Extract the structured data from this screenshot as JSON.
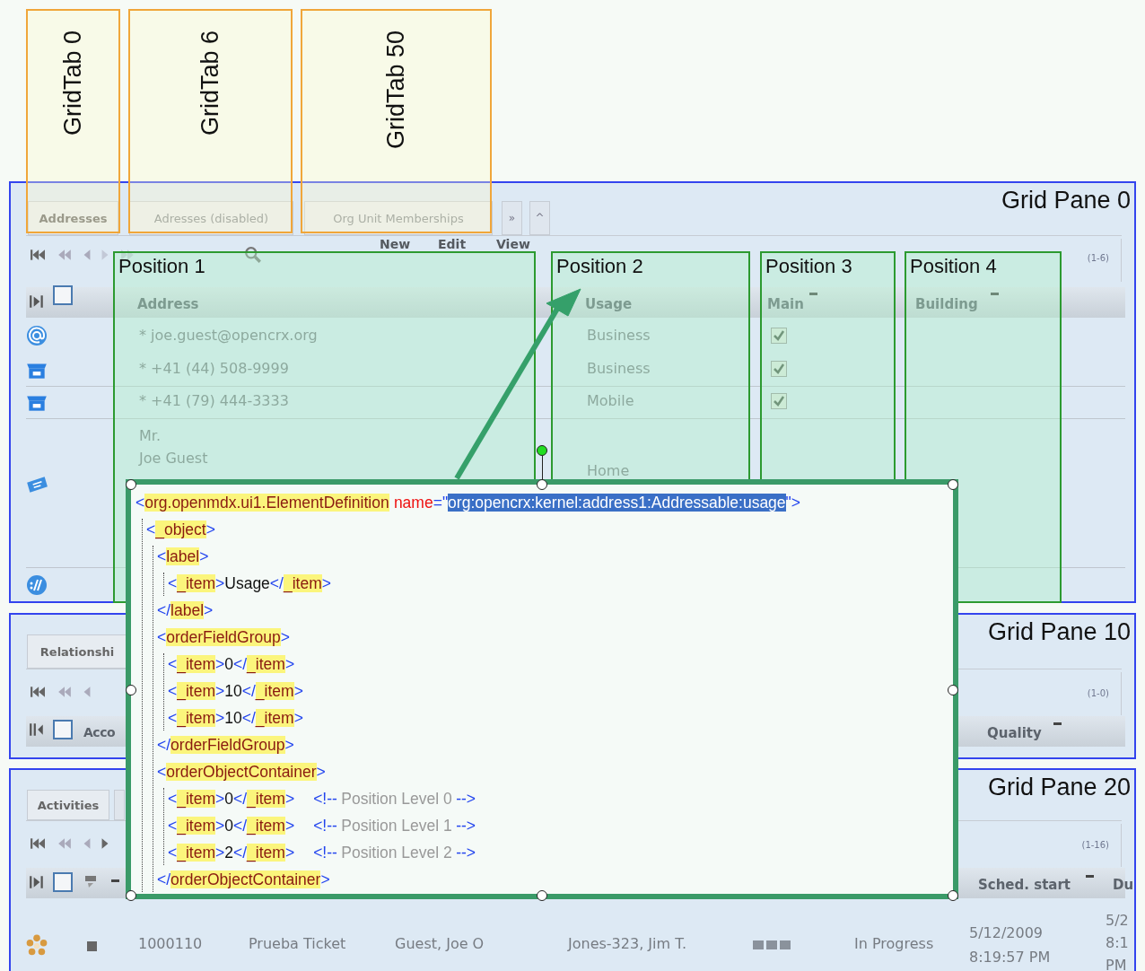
{
  "grid_tabs": [
    {
      "label": "GridTab 0"
    },
    {
      "label": "GridTab 6"
    },
    {
      "label": "GridTab 50"
    }
  ],
  "pane0": {
    "title": "Grid Pane 0",
    "tabs": [
      {
        "label": "Addresses",
        "disabled": false
      },
      {
        "label": "Adresses (disabled)",
        "disabled": true
      },
      {
        "label": "Org Unit Memberships",
        "disabled": true
      }
    ],
    "more": "»",
    "collapse": "^",
    "actions": [
      "New",
      "Edit",
      "View"
    ],
    "count": "(1-6)",
    "select_all": false,
    "columns": [
      {
        "label": "Address",
        "sortable": false
      },
      {
        "label": "Usage",
        "sortable": false
      },
      {
        "label": "Main",
        "sortable": true
      },
      {
        "label": "Building",
        "sortable": true
      }
    ],
    "rows": [
      {
        "kind": "email",
        "address": [
          "* joe.guest@opencrx.org"
        ],
        "usage": "Business",
        "main": true
      },
      {
        "kind": "phone",
        "address": [
          "* +41 (44) 508-9999"
        ],
        "usage": "Business",
        "main": true
      },
      {
        "kind": "phone",
        "address": [
          "* +41 (79) 444-3333"
        ],
        "usage": "Mobile",
        "main": true
      },
      {
        "kind": "postal",
        "address": [
          "Mr.",
          "Joe Guest"
        ],
        "usage": "Home"
      },
      {
        "kind": "web",
        "address": []
      }
    ]
  },
  "position_boxes": [
    "Position 1",
    "Position 2",
    "Position 3",
    "Position 4"
  ],
  "pane10": {
    "title": "Grid Pane 10",
    "tab": "Relationshi",
    "count": "(1-0)",
    "select_all": false,
    "columns": [
      {
        "label": "Acco",
        "sortable": false
      },
      {
        "label": "Quality",
        "sortable": true
      }
    ]
  },
  "pane20": {
    "title": "Grid Pane 20",
    "tab": "Activities",
    "count": "(1-16)",
    "select_all": false,
    "columns": [
      {
        "label": "Sched. start",
        "sortable": true
      },
      {
        "label": "Du",
        "sortable": false
      }
    ],
    "row": {
      "cells": [
        "1000110",
        "Prueba Ticket",
        "Guest, Joe O",
        "Jones-323, Jim T.",
        "In Progress"
      ],
      "sched_start": [
        "5/12/2009",
        "8:19:57 PM"
      ],
      "due": [
        "5/2",
        "8:1",
        "PM"
      ]
    }
  },
  "xml_tree": [
    {
      "parts": [
        {
          "kind": "punct",
          "text": "<"
        },
        {
          "kind": "tag",
          "text": "org.openmdx.ui1.ElementDefinition"
        },
        {
          "kind": "attr",
          "text": "name"
        },
        {
          "kind": "punct",
          "text": "=\""
        },
        {
          "kind": "selected",
          "text": "org:opencrx:kernel:address1:Addressable:usage"
        },
        {
          "kind": "punct",
          "text": "\">"
        }
      ],
      "children": [
        {
          "parts": [
            {
              "kind": "punct",
              "text": "<"
            },
            {
              "kind": "tag",
              "text": "_object"
            },
            {
              "kind": "punct",
              "text": ">"
            }
          ],
          "children": [
            {
              "parts": [
                {
                  "kind": "punct",
                  "text": "<"
                },
                {
                  "kind": "tag",
                  "text": "label"
                },
                {
                  "kind": "punct",
                  "text": ">"
                }
              ],
              "children": [
                {
                  "parts": [
                    {
                      "kind": "punct",
                      "text": "<"
                    },
                    {
                      "kind": "tag",
                      "text": "_item"
                    },
                    {
                      "kind": "punct",
                      "text": ">"
                    },
                    {
                      "kind": "plain",
                      "text": "Usage"
                    },
                    {
                      "kind": "punct",
                      "text": "</"
                    },
                    {
                      "kind": "tag",
                      "text": "_item"
                    },
                    {
                      "kind": "punct",
                      "text": ">"
                    }
                  ]
                }
              ]
            },
            {
              "parts": [
                {
                  "kind": "punct",
                  "text": "</"
                },
                {
                  "kind": "tag",
                  "text": "label"
                },
                {
                  "kind": "punct",
                  "text": ">"
                }
              ]
            },
            {
              "parts": [
                {
                  "kind": "punct",
                  "text": "<"
                },
                {
                  "kind": "tag",
                  "text": "orderFieldGroup"
                },
                {
                  "kind": "punct",
                  "text": ">"
                }
              ],
              "children": [
                {
                  "parts": [
                    {
                      "kind": "punct",
                      "text": "<"
                    },
                    {
                      "kind": "tag",
                      "text": "_item"
                    },
                    {
                      "kind": "punct",
                      "text": ">"
                    },
                    {
                      "kind": "plain",
                      "text": "0"
                    },
                    {
                      "kind": "punct",
                      "text": "</"
                    },
                    {
                      "kind": "tag",
                      "text": "_item"
                    },
                    {
                      "kind": "punct",
                      "text": ">"
                    }
                  ]
                },
                {
                  "parts": [
                    {
                      "kind": "punct",
                      "text": "<"
                    },
                    {
                      "kind": "tag",
                      "text": "_item"
                    },
                    {
                      "kind": "punct",
                      "text": ">"
                    },
                    {
                      "kind": "plain",
                      "text": "10"
                    },
                    {
                      "kind": "punct",
                      "text": "</"
                    },
                    {
                      "kind": "tag",
                      "text": "_item"
                    },
                    {
                      "kind": "punct",
                      "text": ">"
                    }
                  ]
                },
                {
                  "parts": [
                    {
                      "kind": "punct",
                      "text": "<"
                    },
                    {
                      "kind": "tag",
                      "text": "_item"
                    },
                    {
                      "kind": "punct",
                      "text": ">"
                    },
                    {
                      "kind": "plain",
                      "text": "10"
                    },
                    {
                      "kind": "punct",
                      "text": "</"
                    },
                    {
                      "kind": "tag",
                      "text": "_item"
                    },
                    {
                      "kind": "punct",
                      "text": ">"
                    }
                  ]
                }
              ]
            },
            {
              "parts": [
                {
                  "kind": "punct",
                  "text": "</"
                },
                {
                  "kind": "tag",
                  "text": "orderFieldGroup"
                },
                {
                  "kind": "punct",
                  "text": ">"
                }
              ]
            },
            {
              "parts": [
                {
                  "kind": "punct",
                  "text": "<"
                },
                {
                  "kind": "tag",
                  "text": "orderObjectContainer"
                },
                {
                  "kind": "punct",
                  "text": ">"
                }
              ],
              "children": [
                {
                  "parts": [
                    {
                      "kind": "punct",
                      "text": "<"
                    },
                    {
                      "kind": "tag",
                      "text": "_item"
                    },
                    {
                      "kind": "punct",
                      "text": ">"
                    },
                    {
                      "kind": "plain",
                      "text": "0"
                    },
                    {
                      "kind": "punct",
                      "text": "</"
                    },
                    {
                      "kind": "tag",
                      "text": "_item"
                    },
                    {
                      "kind": "punct",
                      "text": ">"
                    },
                    {
                      "kind": "comment_open",
                      "text": "<!--"
                    },
                    {
                      "kind": "comment",
                      "text": "Position Level 0"
                    },
                    {
                      "kind": "comment_close",
                      "text": "-->"
                    }
                  ]
                },
                {
                  "parts": [
                    {
                      "kind": "punct",
                      "text": "<"
                    },
                    {
                      "kind": "tag",
                      "text": "_item"
                    },
                    {
                      "kind": "punct",
                      "text": ">"
                    },
                    {
                      "kind": "plain",
                      "text": "0"
                    },
                    {
                      "kind": "punct",
                      "text": "</"
                    },
                    {
                      "kind": "tag",
                      "text": "_item"
                    },
                    {
                      "kind": "punct",
                      "text": ">"
                    },
                    {
                      "kind": "comment_open",
                      "text": "<!--"
                    },
                    {
                      "kind": "comment",
                      "text": "Position Level 1"
                    },
                    {
                      "kind": "comment_close",
                      "text": "-->"
                    }
                  ]
                },
                {
                  "parts": [
                    {
                      "kind": "punct",
                      "text": "<"
                    },
                    {
                      "kind": "tag",
                      "text": "_item"
                    },
                    {
                      "kind": "punct",
                      "text": ">"
                    },
                    {
                      "kind": "plain",
                      "text": "2"
                    },
                    {
                      "kind": "punct",
                      "text": "</"
                    },
                    {
                      "kind": "tag",
                      "text": "_item"
                    },
                    {
                      "kind": "punct",
                      "text": ">"
                    },
                    {
                      "kind": "comment_open",
                      "text": "<!--"
                    },
                    {
                      "kind": "comment",
                      "text": "Position Level 2"
                    },
                    {
                      "kind": "comment_close",
                      "text": "-->"
                    }
                  ]
                }
              ]
            },
            {
              "parts": [
                {
                  "kind": "punct",
                  "text": "</"
                },
                {
                  "kind": "tag",
                  "text": "orderObjectContainer"
                },
                {
                  "kind": "punct",
                  "text": ">"
                }
              ]
            }
          ]
        }
      ]
    }
  ]
}
